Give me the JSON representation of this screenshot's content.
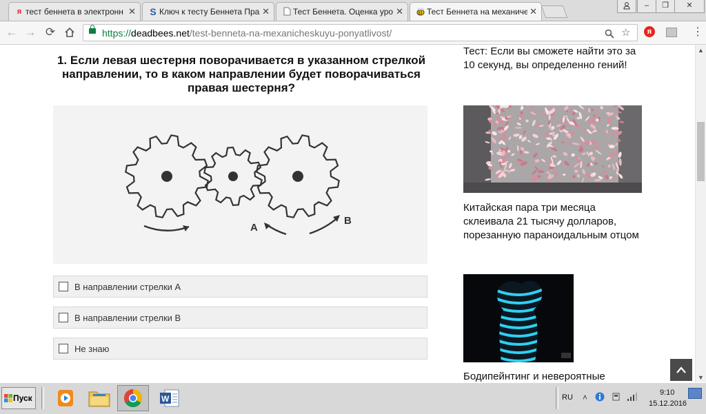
{
  "tabs": [
    {
      "favicon": "я",
      "title": "тест беннета в электронн",
      "active": false
    },
    {
      "favicon": "S",
      "title": "Ключ к тесту Беннета Пра",
      "active": false
    },
    {
      "favicon": "",
      "title": "Тест Беннета. Оценка уро",
      "active": false
    },
    {
      "favicon": "",
      "title": "Тест Беннета на механиче",
      "active": true
    }
  ],
  "window_controls": {
    "user": "user-icon",
    "minimize": "–",
    "restore": "❐",
    "close": "✕"
  },
  "address_bar": {
    "scheme": "https://",
    "host": "deadbees.net",
    "path": "/test-benneta-na-mexanicheskuyu-ponyatlivost/"
  },
  "extensions": {
    "yandex": "я"
  },
  "question": {
    "text": "1. Если левая шестерня поворачивается в указанном стрелкой направлении, то в каком направлении будет поворачиваться правая шестерня?"
  },
  "figure": {
    "label_a": "A",
    "label_b": "B"
  },
  "options": [
    {
      "label": "В направлении стрелки А",
      "checked": false
    },
    {
      "label": "В направлении стрелки В",
      "checked": false
    },
    {
      "label": "Не знаю",
      "checked": false
    }
  ],
  "sidebar": {
    "teaser_top": "Тест: Если вы сможете найти это за 10 секунд, вы определенно гений!",
    "article1": "Китайская пара три месяца склеивала 21 тысячу долларов, порезанную параноидальным отцом",
    "article2": "Бодипейнтинг и невероятные"
  },
  "taskbar": {
    "start_label": "Пуск",
    "apps": [
      "media-player",
      "file-explorer",
      "chrome",
      "word"
    ],
    "language": "RU",
    "time": "9:10",
    "date": "15.12.2016"
  },
  "colors": {
    "secure_green": "#0b8043",
    "yandex_red": "#e52620",
    "body_paint_cyan": "#2fd0f0"
  }
}
